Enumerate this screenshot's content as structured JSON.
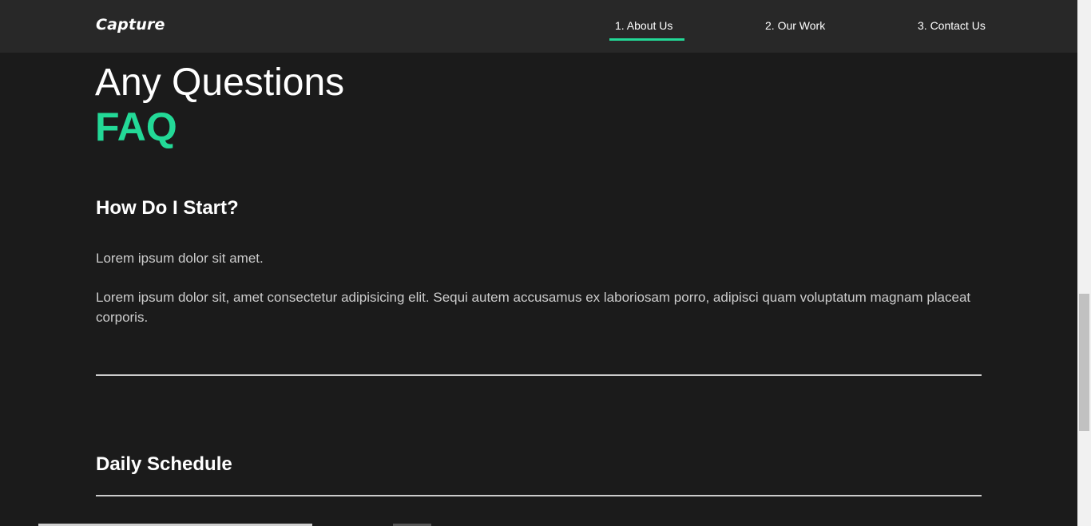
{
  "header": {
    "logo": "Capture",
    "nav": [
      {
        "label": "1. About Us"
      },
      {
        "label": "2. Our Work"
      },
      {
        "label": "3. Contact Us"
      }
    ]
  },
  "hero": {
    "title": "Any Questions",
    "accent": "FAQ"
  },
  "faq": [
    {
      "question": "How Do I Start?",
      "answers": [
        "Lorem ipsum dolor sit amet.",
        "Lorem ipsum dolor sit, amet consectetur adipisicing elit. Sequi autem accusamus ex laboriosam porro, adipisci quam voluptatum magnam placeat corporis."
      ]
    },
    {
      "question": "Daily Schedule"
    }
  ],
  "colors": {
    "accent": "#23d997",
    "background": "#1b1b1b",
    "header": "#282828"
  }
}
